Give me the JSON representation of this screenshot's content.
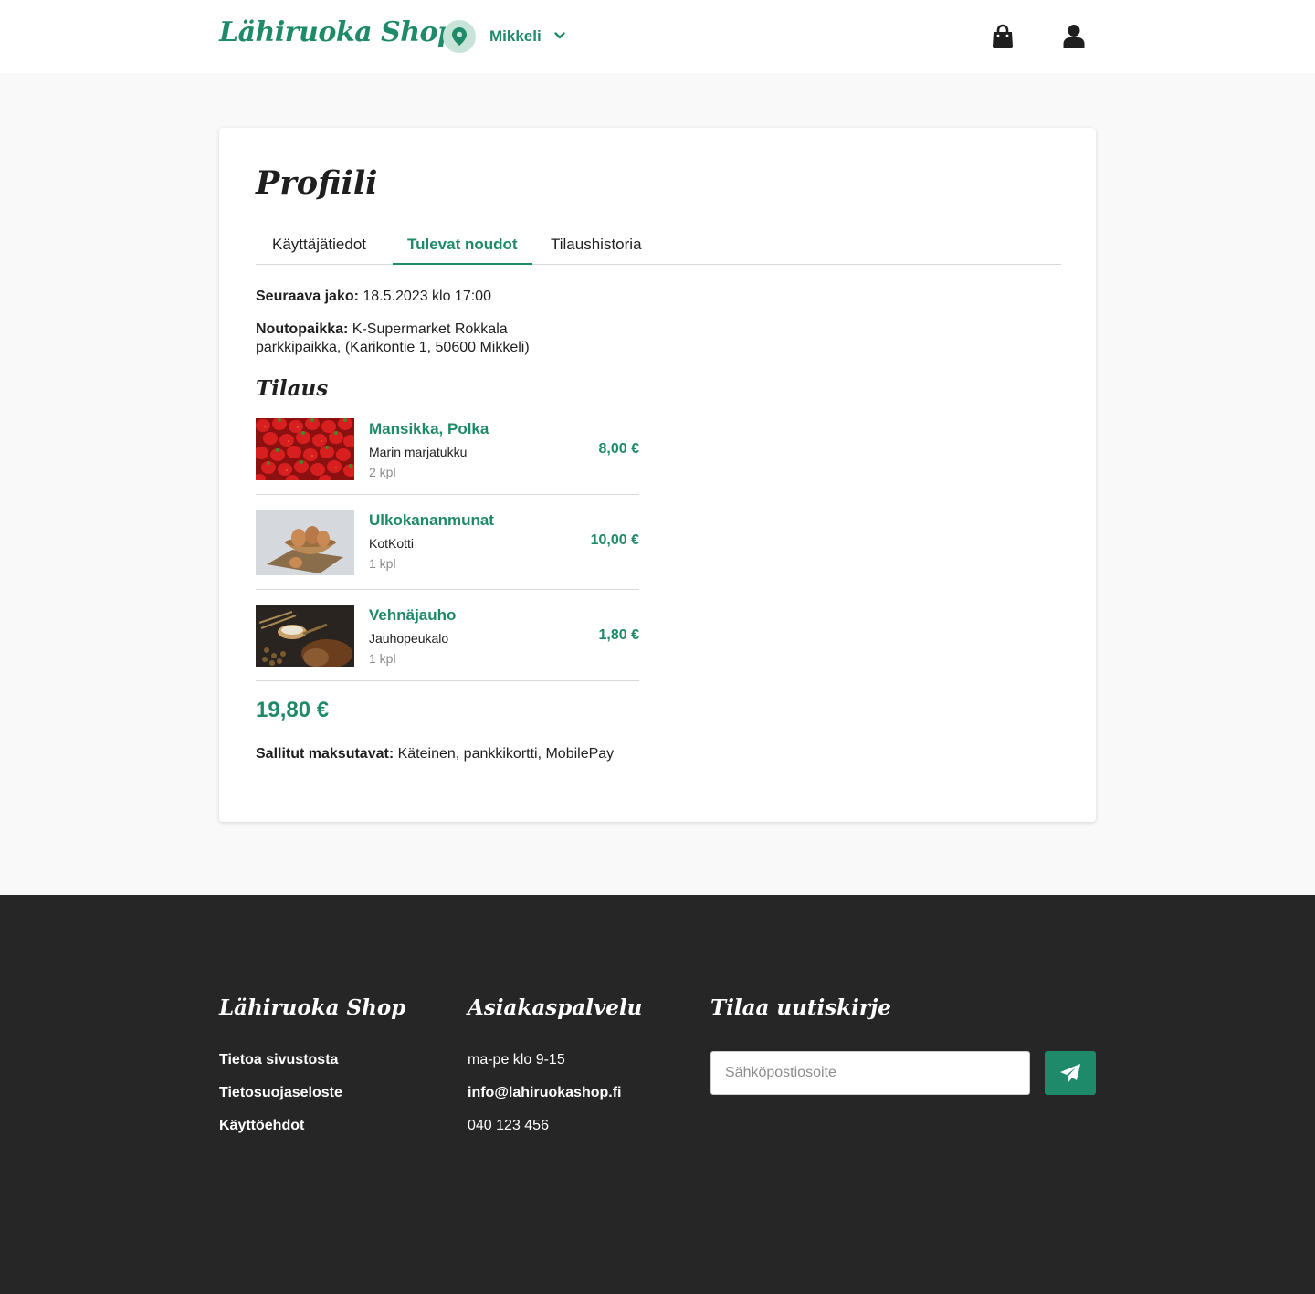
{
  "header": {
    "logo": "Lähiruoka Shop",
    "location": "Mikkeli",
    "icons": {
      "location": "map-pin-icon",
      "chevron": "chevron-down-icon",
      "cart": "shopping-bag-icon",
      "account": "user-icon"
    }
  },
  "profile": {
    "title": "Profiili",
    "tabs": [
      {
        "label": "Käyttäjätiedot",
        "active": false
      },
      {
        "label": "Tulevat noudot",
        "active": true
      },
      {
        "label": "Tilaushistoria",
        "active": false
      }
    ],
    "next_distribution": {
      "label": "Seuraava jako:",
      "value": "18.5.2023 klo 17:00"
    },
    "pickup": {
      "label": "Noutopaikka:",
      "value": "K-Supermarket Rokkala parkkipaikka, (Karikontie 1, 50600 Mikkeli)"
    },
    "order_title": "Tilaus",
    "items": [
      {
        "name": "Mansikka, Polka",
        "seller": "Marin marjatukku",
        "quantity": "2 kpl",
        "price": "8,00 €",
        "image": "strawberries"
      },
      {
        "name": "Ulkokananmunat",
        "seller": "KotKotti",
        "quantity": "1 kpl",
        "price": "10,00 €",
        "image": "eggs-in-bowl"
      },
      {
        "name": "Vehnäjauho",
        "seller": "Jauhopeukalo",
        "quantity": "1 kpl",
        "price": "1,80 €",
        "image": "flour-and-bread"
      }
    ],
    "total": "19,80 €",
    "payment": {
      "label": "Sallitut maksutavat:",
      "value": "Käteinen, pankkikortti, MobilePay"
    }
  },
  "footer": {
    "col1": {
      "title": "Lähiruoka Shop",
      "links": [
        "Tietoa sivustosta",
        "Tietosuojaseloste",
        "Käyttöehdot"
      ]
    },
    "col2": {
      "title": "Asiakaspalvelu",
      "hours": "ma-pe klo 9-15",
      "email": "info@lahiruokashop.fi",
      "phone": "040 123 456"
    },
    "col3": {
      "title": "Tilaa uutiskirje",
      "placeholder": "Sähköpostiosoite",
      "submit_icon": "paper-plane-icon"
    }
  },
  "colors": {
    "brand": "#1f8a6a",
    "pin_bg": "#c8e3d8",
    "footer_bg": "#262626",
    "page_bg": "#f9f9f9"
  }
}
